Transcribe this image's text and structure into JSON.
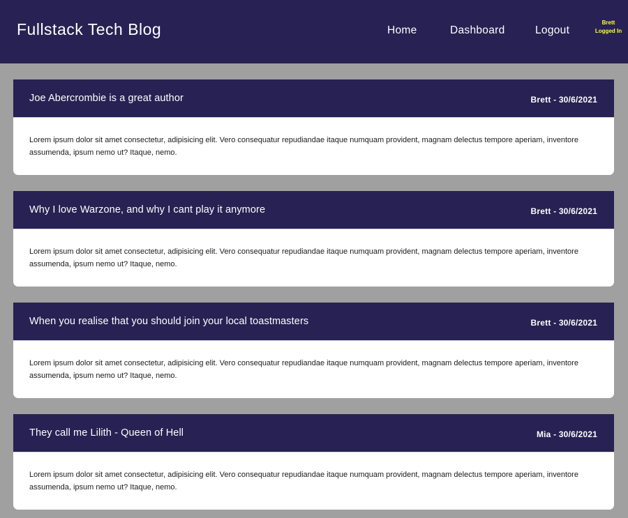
{
  "header": {
    "brand": "Fullstack Tech Blog",
    "nav": {
      "home": "Home",
      "dashboard": "Dashboard",
      "logout": "Logout"
    },
    "user": {
      "name": "Brett",
      "status": "Logged In"
    }
  },
  "posts": [
    {
      "title": "Joe Abercrombie is a great author",
      "meta": "Brett - 30/6/2021",
      "body": "Lorem ipsum dolor sit amet consectetur, adipisicing elit. Vero consequatur repudiandae itaque numquam provident, magnam delectus tempore aperiam, inventore assumenda, ipsum nemo ut? Itaque, nemo."
    },
    {
      "title": "Why I love Warzone, and why I cant play it anymore",
      "meta": "Brett - 30/6/2021",
      "body": "Lorem ipsum dolor sit amet consectetur, adipisicing elit. Vero consequatur repudiandae itaque numquam provident, magnam delectus tempore aperiam, inventore assumenda, ipsum nemo ut? Itaque, nemo."
    },
    {
      "title": "When you realise that you should join your local toastmasters",
      "meta": "Brett - 30/6/2021",
      "body": "Lorem ipsum dolor sit amet consectetur, adipisicing elit. Vero consequatur repudiandae itaque numquam provident, magnam delectus tempore aperiam, inventore assumenda, ipsum nemo ut? Itaque, nemo."
    },
    {
      "title": "They call me Lilith - Queen of Hell",
      "meta": "Mia - 30/6/2021",
      "body": "Lorem ipsum dolor sit amet consectetur, adipisicing elit. Vero consequatur repudiandae itaque numquam provident, magnam delectus tempore aperiam, inventore assumenda, ipsum nemo ut? Itaque, nemo."
    }
  ],
  "colors": {
    "header_bg": "#282153",
    "page_bg": "#a0a0a0",
    "user_status": "#ffff40"
  }
}
